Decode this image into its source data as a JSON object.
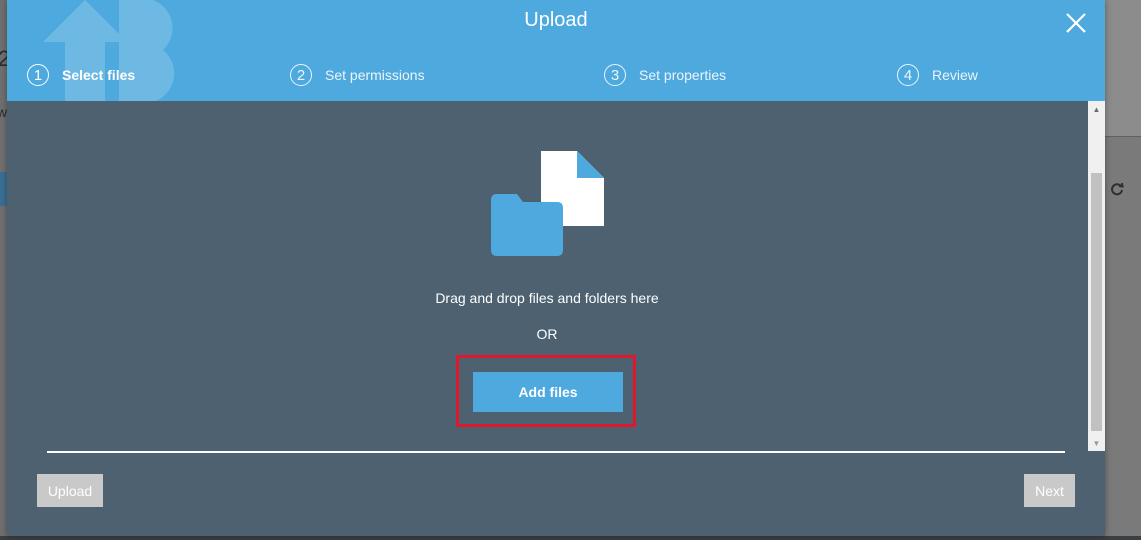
{
  "modal": {
    "title": "Upload",
    "steps": [
      {
        "number": "1",
        "label": "Select files",
        "active": true
      },
      {
        "number": "2",
        "label": "Set permissions",
        "active": false
      },
      {
        "number": "3",
        "label": "Set properties",
        "active": false
      },
      {
        "number": "4",
        "label": "Review",
        "active": false
      }
    ],
    "drop_text": "Drag and drop files and folders here",
    "or_text": "OR",
    "add_files_label": "Add files",
    "footer": {
      "upload_label": "Upload",
      "next_label": "Next"
    }
  },
  "background": {
    "left_digit": "2",
    "left_letter": "w"
  },
  "colors": {
    "header_blue": "#4ea9de",
    "body_slate": "#4d6170",
    "highlight_red": "#e0182e",
    "disabled_grey": "#c9c9c9"
  },
  "icons": {
    "close": "close-icon",
    "file": "file-icon",
    "folder": "folder-icon",
    "refresh": "refresh-icon",
    "watermark": "upload-arrow-icon"
  }
}
